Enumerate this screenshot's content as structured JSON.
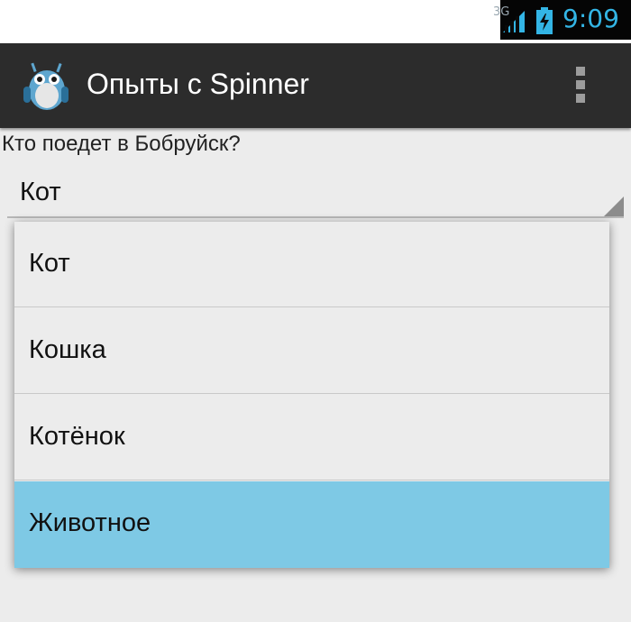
{
  "status_bar": {
    "network_label": "3G",
    "time": "9:09",
    "accent_color": "#33b5e5"
  },
  "action_bar": {
    "title": "Опыты с Spinner",
    "app_icon": "android-robot-icon",
    "overflow_icon": "overflow-menu-icon"
  },
  "content": {
    "prompt": "Кто поедет в Бобруйск?",
    "spinner_selected": "Кот"
  },
  "dropdown": {
    "options": [
      "Кот",
      "Кошка",
      "Котёнок",
      "Животное"
    ],
    "highlighted_index": 3,
    "highlight_color": "#7ec9e5"
  }
}
